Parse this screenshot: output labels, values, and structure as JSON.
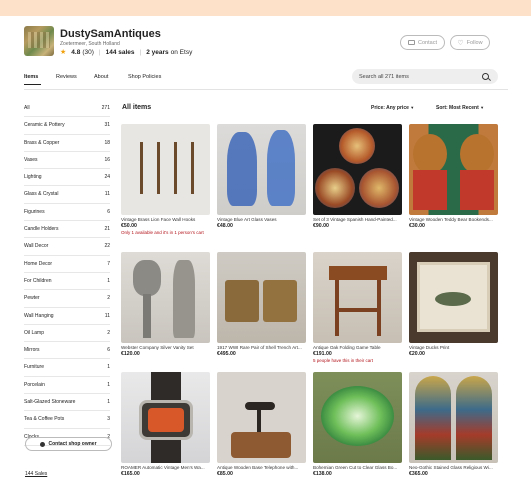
{
  "shop": {
    "name": "DustySamAntiques",
    "location": "Zoetermeer, South Holland",
    "rating": "4.8",
    "reviews": "(30)",
    "sales": "144 sales",
    "years": "2 years",
    "years_suffix": "on Etsy",
    "contact_label": "Contact",
    "follow_label": "Follow"
  },
  "tabs": [
    "Items",
    "Reviews",
    "About",
    "Shop Policies"
  ],
  "search": {
    "placeholder": "Search all 271 items"
  },
  "sidebar": {
    "categories": [
      {
        "name": "All",
        "count": "271"
      },
      {
        "name": "Ceramic & Pottery",
        "count": "31"
      },
      {
        "name": "Brass & Copper",
        "count": "18"
      },
      {
        "name": "Vases",
        "count": "16"
      },
      {
        "name": "Lighting",
        "count": "24"
      },
      {
        "name": "Glass & Crystal",
        "count": "11"
      },
      {
        "name": "Figurines",
        "count": "6"
      },
      {
        "name": "Candle Holders",
        "count": "21"
      },
      {
        "name": "Wall Decor",
        "count": "22"
      },
      {
        "name": "Home Decor",
        "count": "7"
      },
      {
        "name": "For Children",
        "count": "1"
      },
      {
        "name": "Pewter",
        "count": "2"
      },
      {
        "name": "Wall Hanging",
        "count": "11"
      },
      {
        "name": "Oil Lamp",
        "count": "2"
      },
      {
        "name": "Mirrors",
        "count": "6"
      },
      {
        "name": "Furniture",
        "count": "1"
      },
      {
        "name": "Porcelain",
        "count": "1"
      },
      {
        "name": "Salt-Glazed Stoneware",
        "count": "1"
      },
      {
        "name": "Tea & Coffee Pots",
        "count": "3"
      },
      {
        "name": "Clocks",
        "count": "2"
      }
    ],
    "contact_owner": "Contact shop owner",
    "sales_link": "144 Sales"
  },
  "main": {
    "heading": "All items",
    "price_filter": "Price: Any price",
    "sort": "Sort: Most Recent"
  },
  "listings": [
    {
      "title": "Vintage Brass Lion Face Wall Hooks",
      "price": "€50.00",
      "note": "Only 1 available and it's in 1 person's cart"
    },
    {
      "title": "Vintage Blue Art Glass Vases",
      "price": "€48.00",
      "note": ""
    },
    {
      "title": "Set of 3 Vintage Spanish Hand-Painted...",
      "price": "€90.00",
      "note": ""
    },
    {
      "title": "Vintage Wooden Teddy Bear Bookends...",
      "price": "€30.00",
      "note": ""
    },
    {
      "title": "Webster Company Silver Vanity Set",
      "price": "€120.00",
      "note": ""
    },
    {
      "title": "1917 WWI Rare Pair of Shell Trench Art...",
      "price": "€495.00",
      "note": ""
    },
    {
      "title": "Antique Oak Folding Game Table",
      "price": "€191.00",
      "note": "5 people have this in their cart"
    },
    {
      "title": "Vintage Ducks Print",
      "price": "€20.00",
      "note": ""
    },
    {
      "title": "ROAMER Automatic Vintage Men's Wa...",
      "price": "€165.00",
      "note": ""
    },
    {
      "title": "Antique Wooden Base Telephone with...",
      "price": "€85.00",
      "note": ""
    },
    {
      "title": "Bohemian Green Cut to Clear Glass Bo...",
      "price": "€138.00",
      "note": ""
    },
    {
      "title": "Neo-Gothic Stained Glass Religious Wi...",
      "price": "€365.00",
      "note": ""
    }
  ],
  "icons": {
    "star": "star-icon",
    "contact": "mail-icon",
    "follow": "heart-icon",
    "search": "search-icon",
    "dropdown": "chevron-down-icon"
  }
}
